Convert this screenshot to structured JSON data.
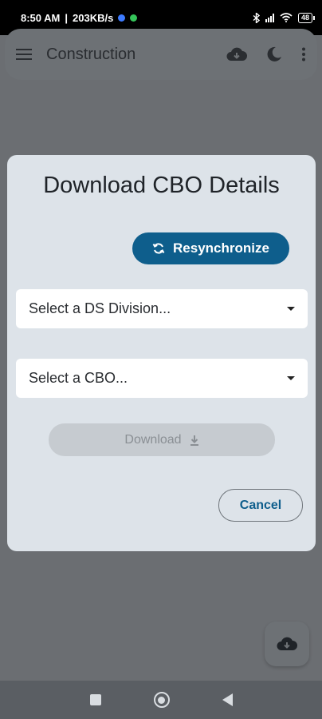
{
  "status_bar": {
    "time": "8:50 AM",
    "net_speed": "203KB/s",
    "battery": "48"
  },
  "app_bar": {
    "menu_icon": "hamburger-menu-icon",
    "title": "Construction",
    "actions": [
      "cloud-download-icon",
      "dark-mode-moon-icon",
      "more-vert-icon"
    ]
  },
  "dialog": {
    "title": "Download CBO Details",
    "resync_label": "Resynchronize",
    "ds_division_placeholder": "Select a DS Division...",
    "cbo_placeholder": "Select a CBO...",
    "download_label": "Download",
    "cancel_label": "Cancel"
  },
  "fab": {
    "icon": "cloud-download-icon"
  },
  "nav": [
    "recents-square-icon",
    "home-circle-icon",
    "back-triangle-icon"
  ],
  "colors": {
    "primary": "#0e5e8c",
    "dialog_bg": "#dde3e9",
    "scrim": "#6b6e72",
    "disabled_bg": "#c6cbd0",
    "disabled_text": "#8a8f94"
  }
}
